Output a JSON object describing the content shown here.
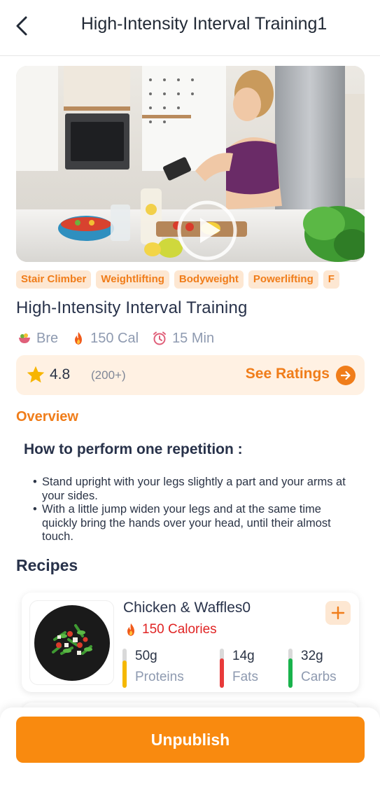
{
  "header": {
    "title": "High-Intensity Interval Training1",
    "back_icon": "chevron-left-icon"
  },
  "hero": {
    "play_icon": "play-icon"
  },
  "tags": [
    "Stair Climber",
    "Weightlifting",
    "Bodyweight",
    "Powerlifting",
    "F"
  ],
  "workout": {
    "title": "High-Intensity Interval Training",
    "meal_type": "Bre",
    "calories": "150 Cal",
    "duration": "15 Min"
  },
  "rating": {
    "value": "4.8",
    "count": "(200+)",
    "see_label": "See Ratings"
  },
  "overview": {
    "tab_label": "Overview",
    "heading": "How to perform one repetition :",
    "steps": [
      "Stand upright with your legs slightly a part and your arms at your sides.",
      "With a little jump widen your legs and at the same time quickly bring the hands over your head, until their almost touch."
    ]
  },
  "recipes": {
    "heading": "Recipes",
    "items": [
      {
        "name": "Chicken & Waffles0",
        "calories": "150 Calories",
        "macros": [
          {
            "value": "50g",
            "label": "Proteins",
            "color": "#f5b800",
            "level": 0.7
          },
          {
            "value": "14g",
            "label": "Fats",
            "color": "#e83a3a",
            "level": 0.75
          },
          {
            "value": "32g",
            "label": "Carbs",
            "color": "#19b34c",
            "level": 0.75
          }
        ]
      }
    ]
  },
  "actions": {
    "unpublish_label": "Unpublish"
  },
  "colors": {
    "accent": "#f07d1a",
    "button": "#f98a0f",
    "tag_bg": "#fde7d2",
    "rating_bg": "#fff1e3",
    "calories_red": "#e02424"
  }
}
